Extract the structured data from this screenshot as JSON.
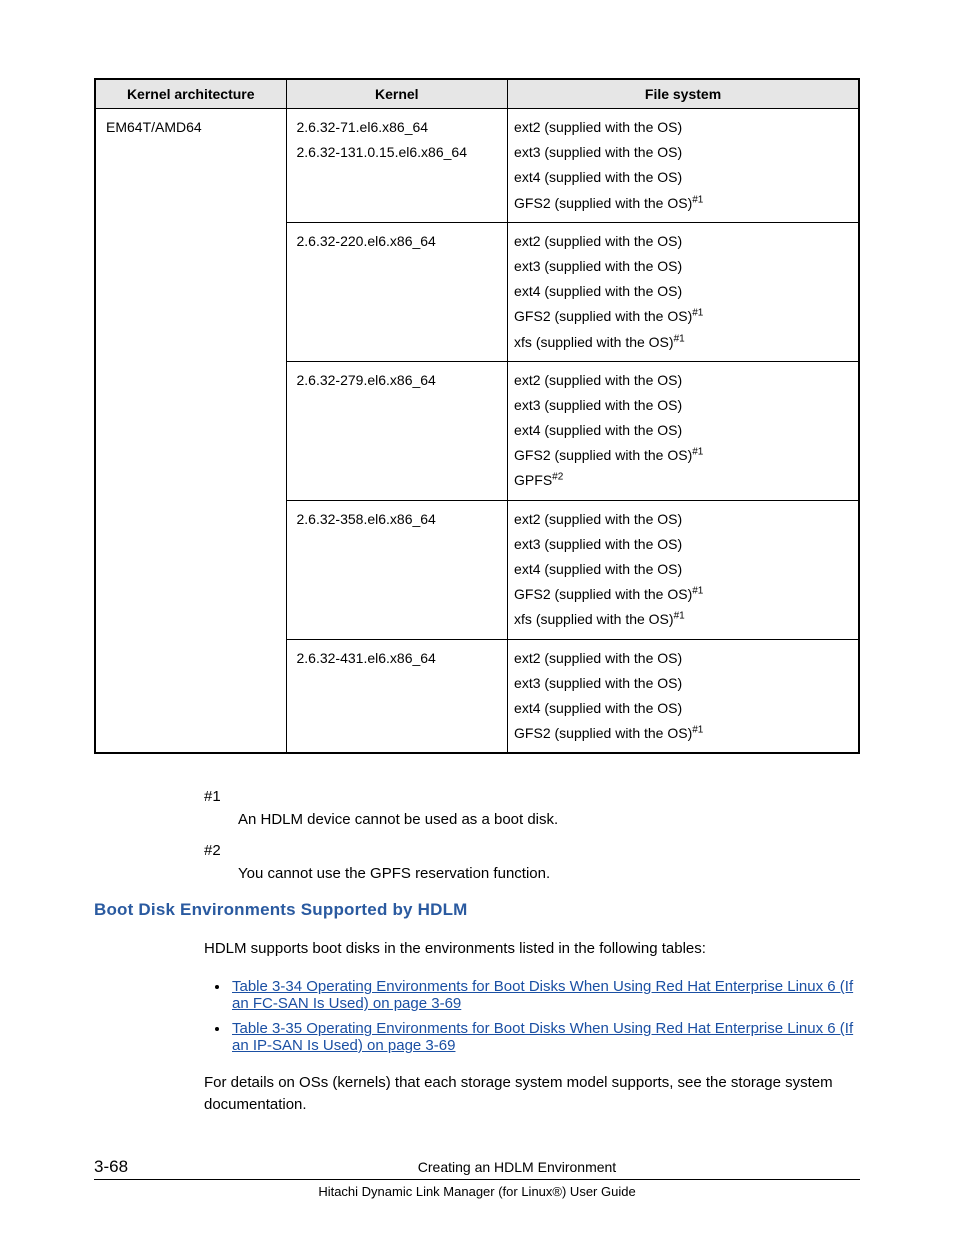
{
  "table": {
    "headers": [
      "Kernel architecture",
      "Kernel",
      "File system"
    ],
    "arch": "EM64T/AMD64",
    "rows": [
      {
        "kernels": [
          "2.6.32-71.el6.x86_64",
          "2.6.32-131.0.15.el6.x86_64"
        ],
        "fs": [
          {
            "text": "ext2 (supplied with the OS)"
          },
          {
            "text": "ext3 (supplied with the OS)"
          },
          {
            "text": "ext4 (supplied with the OS)"
          },
          {
            "text": "GFS2 (supplied with the OS)",
            "sup": "#1"
          }
        ]
      },
      {
        "kernels": [
          "2.6.32-220.el6.x86_64"
        ],
        "fs": [
          {
            "text": "ext2 (supplied with the OS)"
          },
          {
            "text": "ext3 (supplied with the OS)"
          },
          {
            "text": "ext4 (supplied with the OS)"
          },
          {
            "text": "GFS2 (supplied with the OS)",
            "sup": "#1"
          },
          {
            "text": "xfs (supplied with the OS)",
            "sup": "#1"
          }
        ]
      },
      {
        "kernels": [
          "2.6.32-279.el6.x86_64"
        ],
        "fs": [
          {
            "text": "ext2 (supplied with the OS)"
          },
          {
            "text": "ext3 (supplied with the OS)"
          },
          {
            "text": "ext4 (supplied with the OS)"
          },
          {
            "text": "GFS2 (supplied with the OS)",
            "sup": "#1"
          },
          {
            "text": "GPFS",
            "sup": "#2"
          }
        ]
      },
      {
        "kernels": [
          "2.6.32-358.el6.x86_64"
        ],
        "fs": [
          {
            "text": "ext2 (supplied with the OS)"
          },
          {
            "text": "ext3 (supplied with the OS)"
          },
          {
            "text": "ext4 (supplied with the OS)"
          },
          {
            "text": "GFS2 (supplied with the OS)",
            "sup": "#1"
          },
          {
            "text": "xfs (supplied with the OS)",
            "sup": "#1"
          }
        ]
      },
      {
        "kernels": [
          "2.6.32-431.el6.x86_64"
        ],
        "fs": [
          {
            "text": "ext2 (supplied with the OS)"
          },
          {
            "text": "ext3 (supplied with the OS)"
          },
          {
            "text": "ext4 (supplied with the OS)"
          },
          {
            "text": "GFS2 (supplied with the OS)",
            "sup": "#1"
          }
        ]
      }
    ]
  },
  "notes": {
    "n1_label": "#1",
    "n1_text": "An HDLM device cannot be used as a boot disk.",
    "n2_label": "#2",
    "n2_text": "You cannot use the GPFS reservation function."
  },
  "section_heading": "Boot Disk Environments Supported by HDLM",
  "body": {
    "intro": "HDLM supports boot disks in the environments listed in the following tables:",
    "link1": "Table 3-34 Operating Environments for Boot Disks When Using Red Hat Enterprise Linux 6 (If an FC-SAN Is Used) on page 3-69",
    "link2": "Table 3-35 Operating Environments for Boot Disks When Using Red Hat Enterprise Linux 6 (If an IP-SAN Is Used) on page 3-69",
    "outro": "For details on OSs (kernels) that each storage system model supports, see the storage system documentation."
  },
  "footer": {
    "page": "3-68",
    "title": "Creating an HDLM Environment",
    "sub": "Hitachi Dynamic Link Manager (for Linux®) User Guide"
  }
}
